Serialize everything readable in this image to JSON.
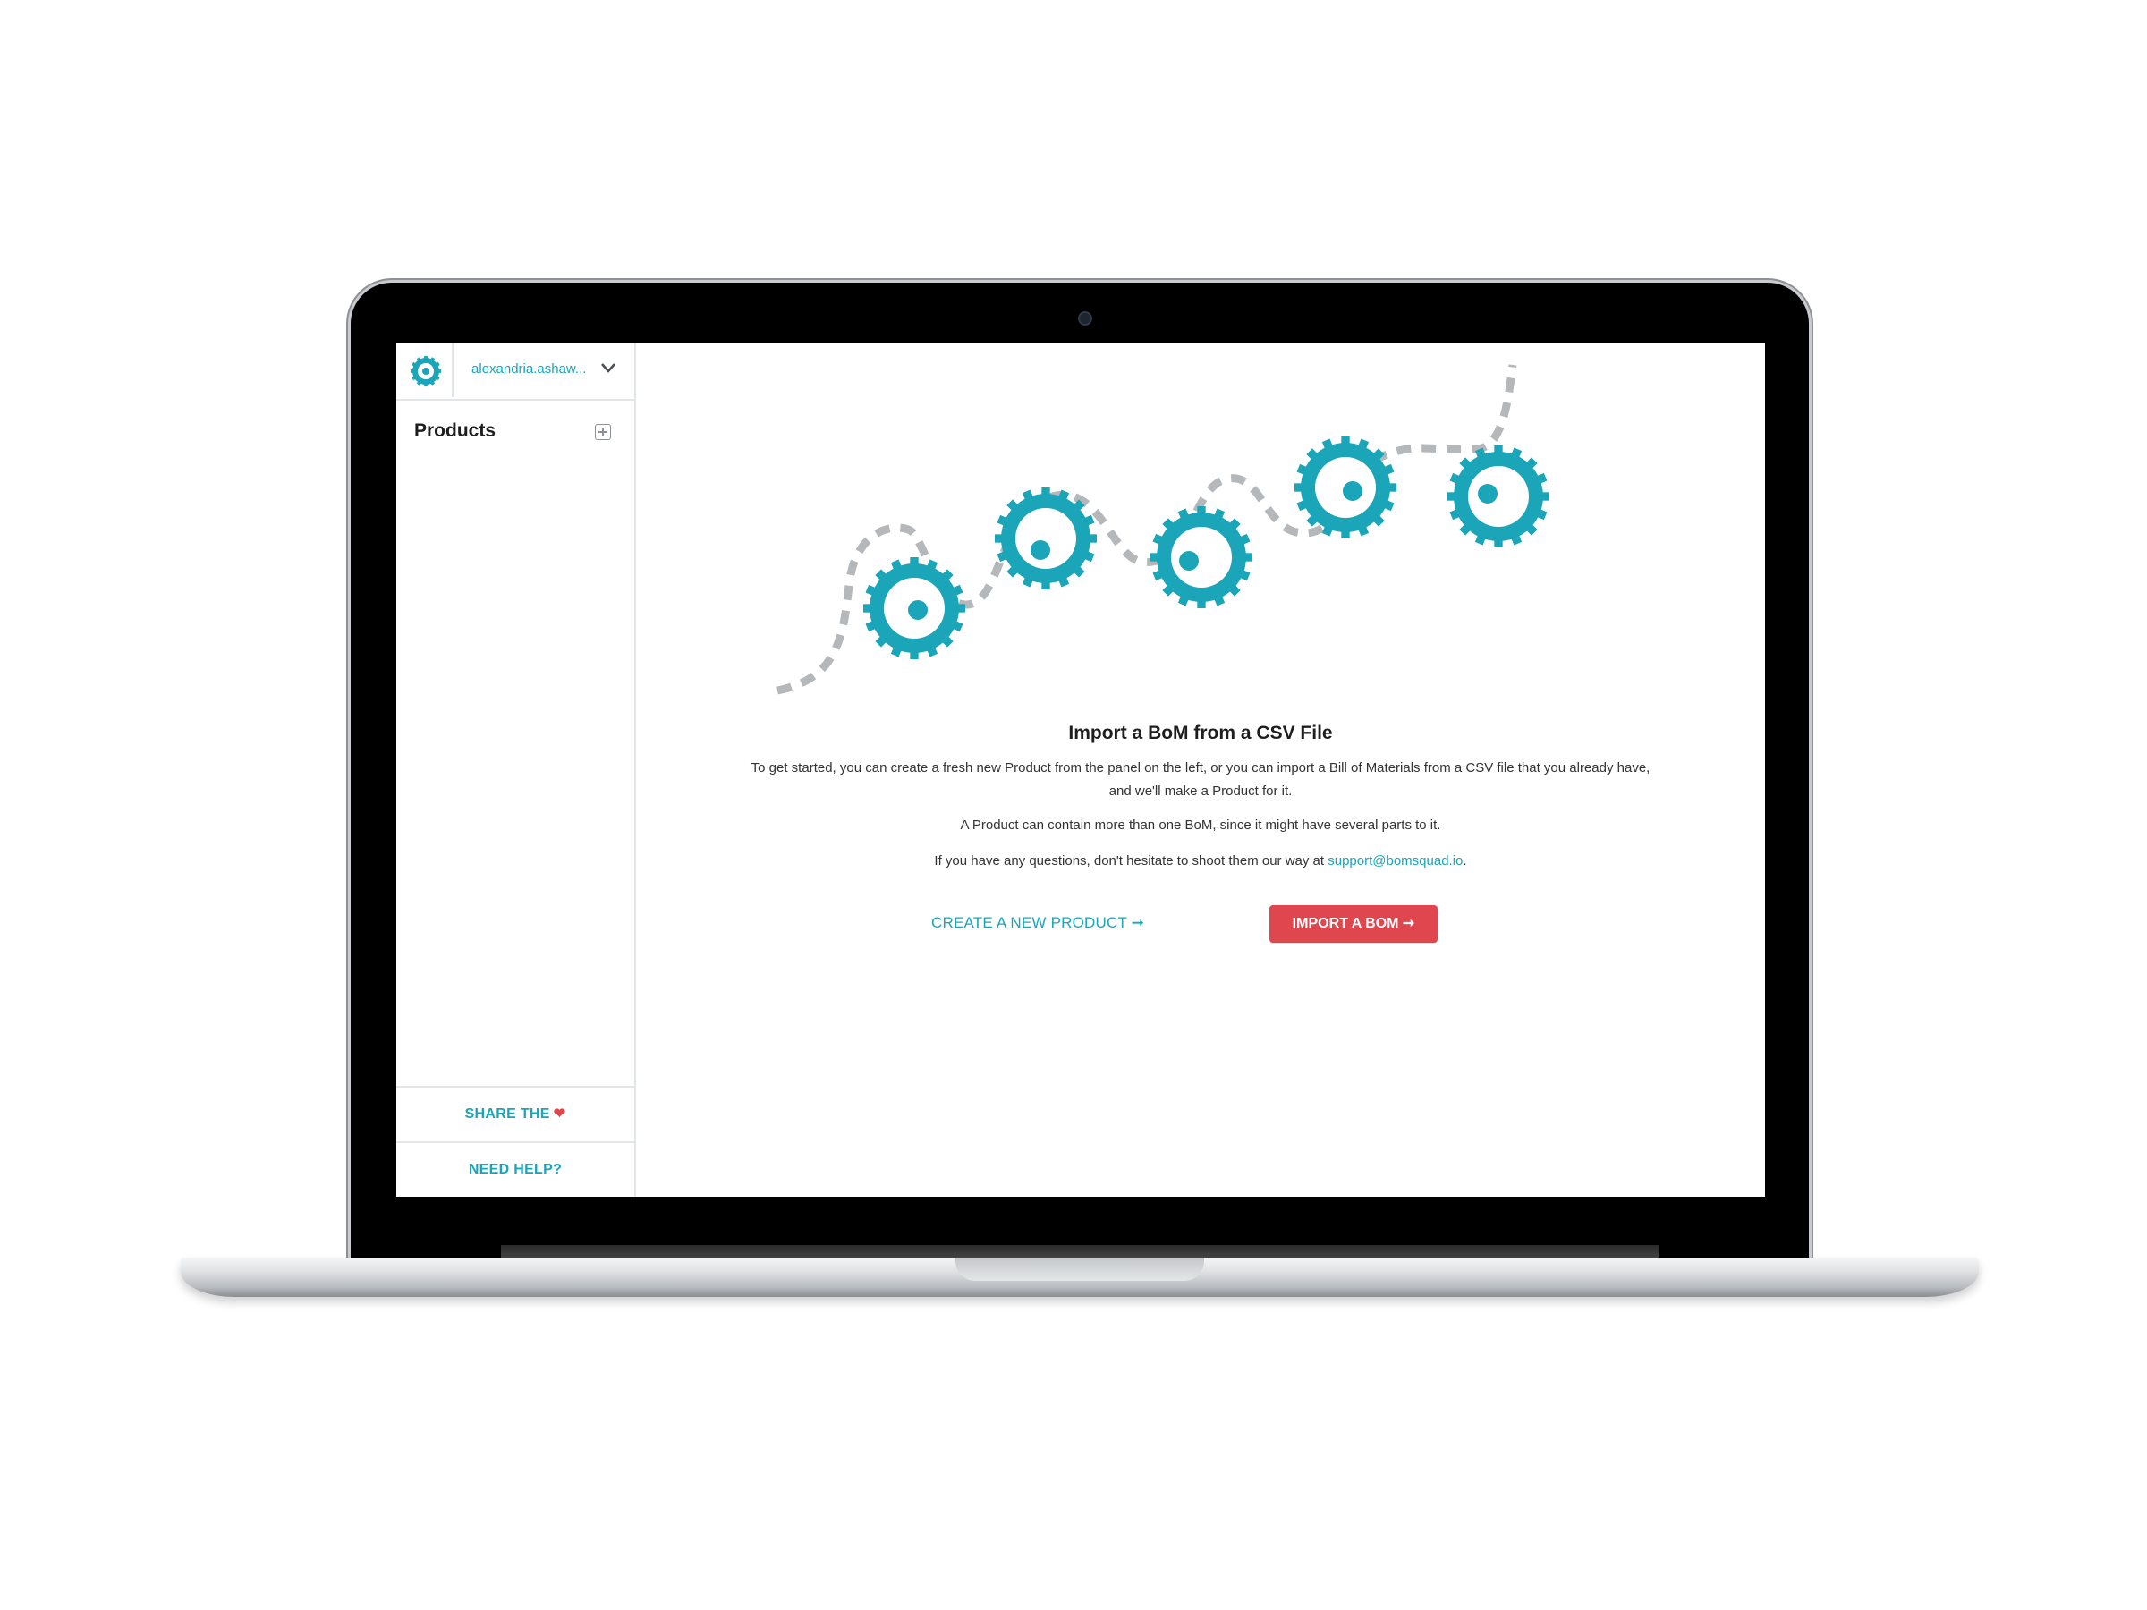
{
  "sidebar": {
    "user_name": "alexandria.ashaw...",
    "products_title": "Products",
    "share_label": "SHARE THE",
    "share_heart": "❤",
    "help_label": "NEED HELP?"
  },
  "main": {
    "title": "Import a BoM from a CSV File",
    "intro": "To get started, you can create a fresh new Product from the panel on the left, or you can import a Bill of Materials from a CSV file that you already have, and we'll make a Product for it.",
    "bom_note": "A Product can contain more than one BoM, since it might have several parts to it.",
    "questions_prefix": "If you have any questions, don't hesitate to shoot them our way at",
    "support_email": "support@bomsquad.io",
    "questions_suffix": ".",
    "create_product_label": "CREATE A NEW PRODUCT ➞",
    "import_bom_label": "IMPORT A BOM ➞"
  },
  "colors": {
    "accent": "#1aa5b8",
    "danger": "#e0464d",
    "path": "#b5b8bb"
  },
  "icons": {
    "logo": "gear-logo-icon",
    "chevron": "chevron-down-icon",
    "add": "add-square-icon",
    "heart": "heart-icon"
  }
}
